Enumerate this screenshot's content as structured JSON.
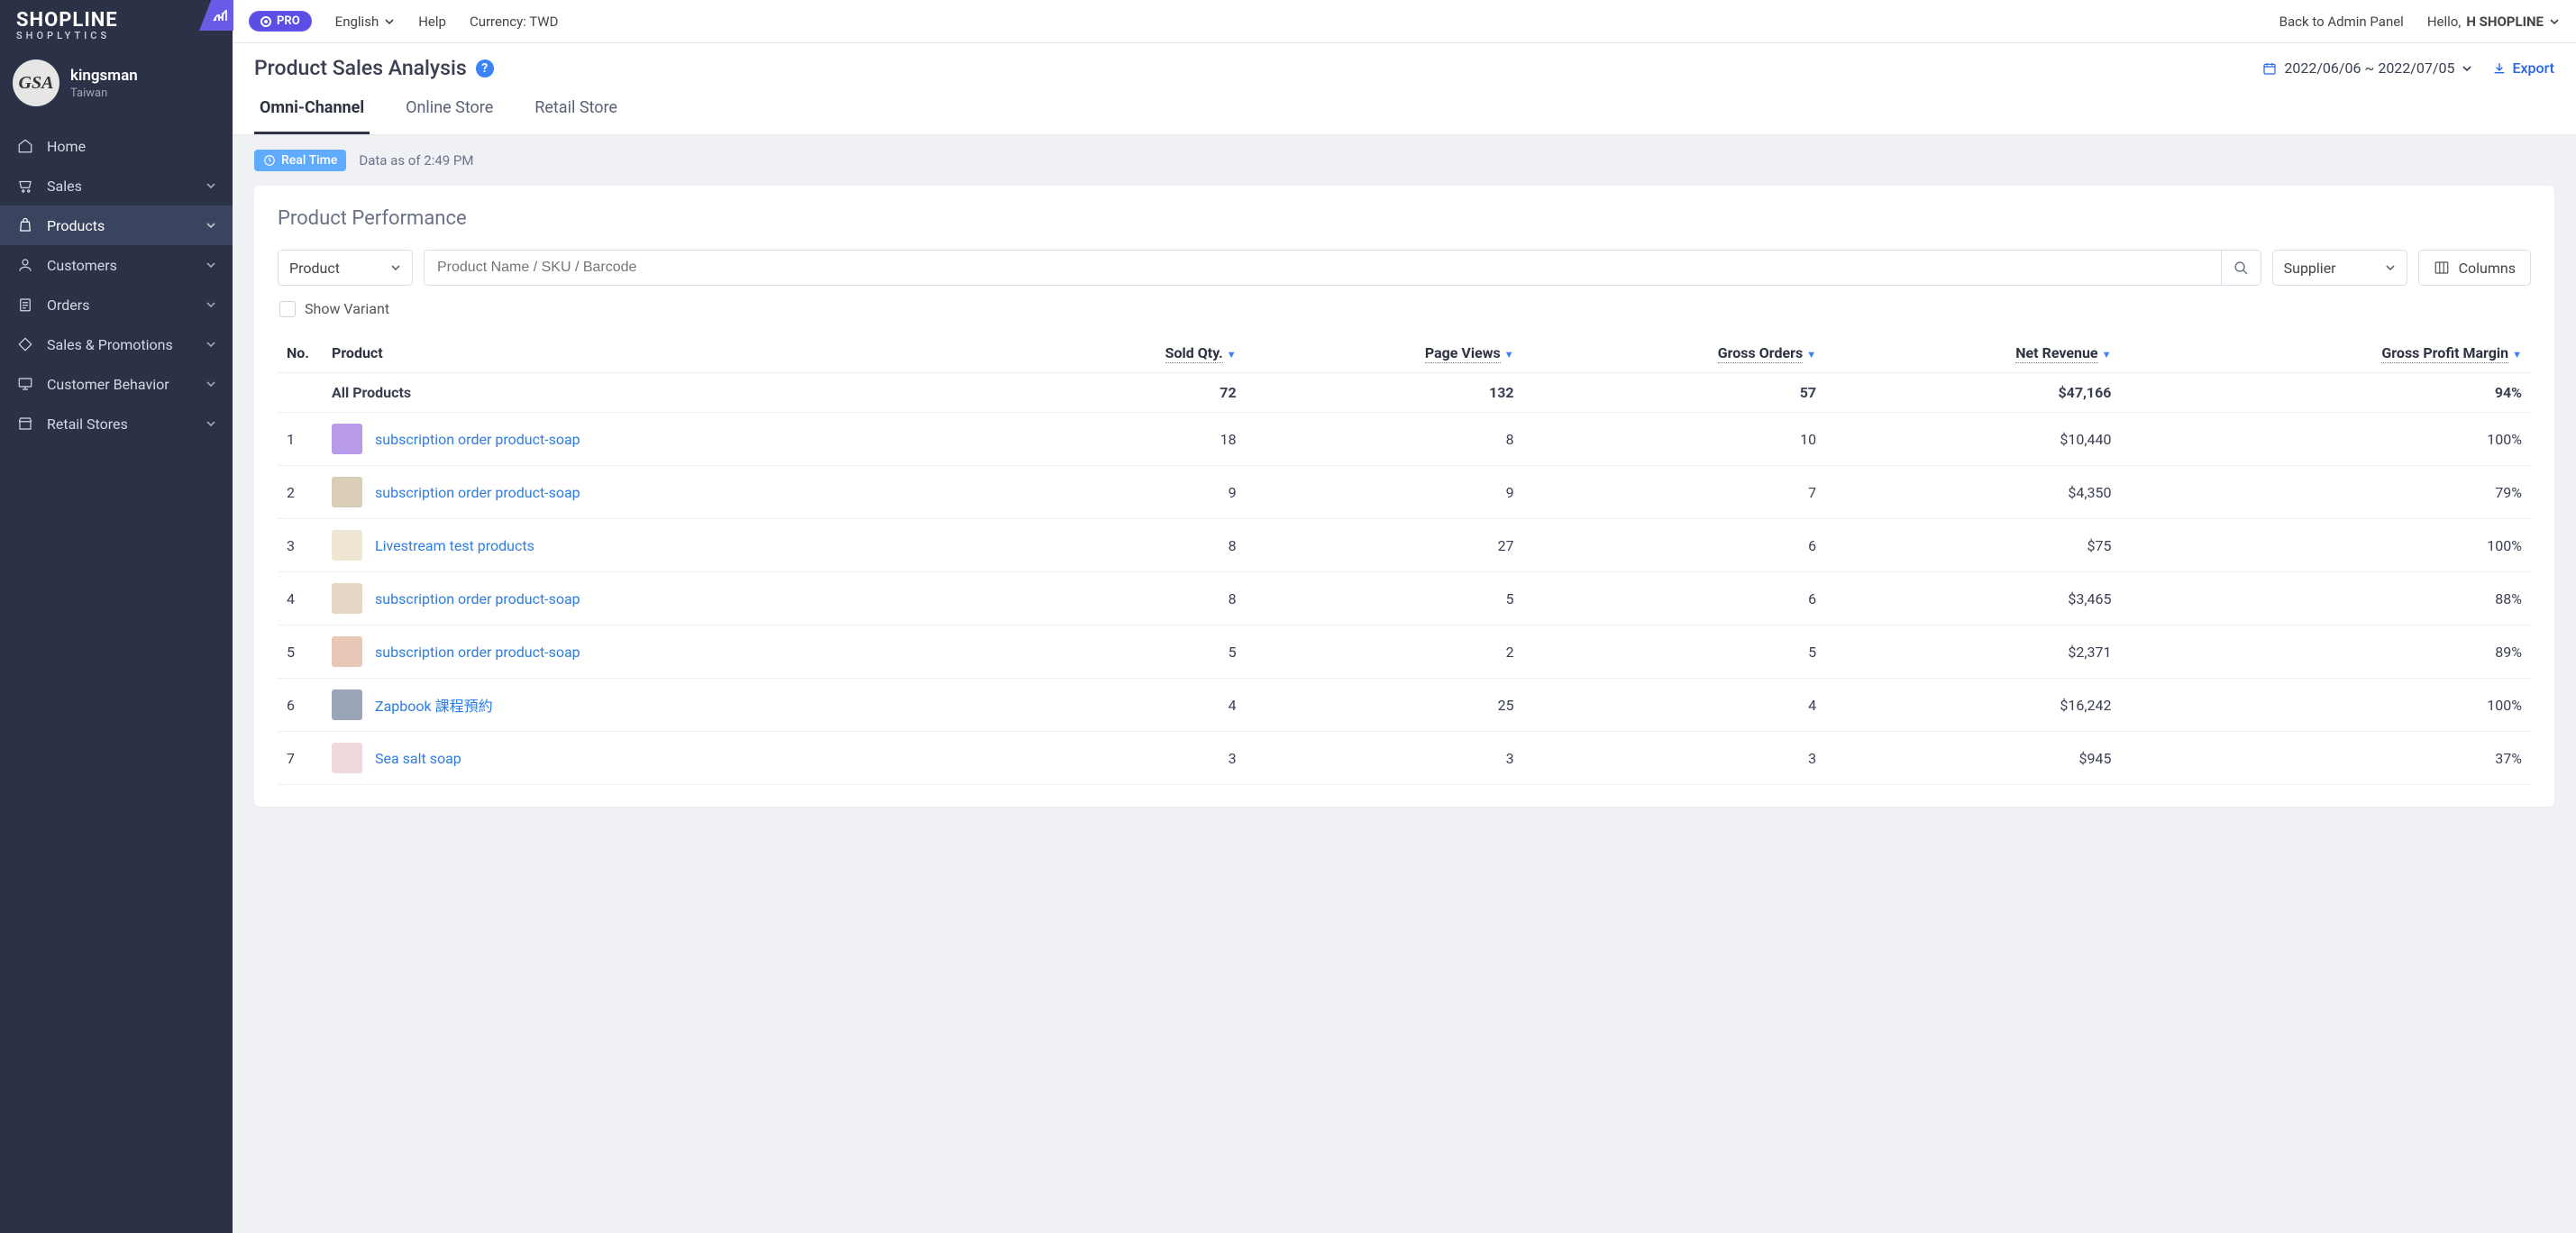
{
  "brand": {
    "name": "SHOPLINE",
    "sub": "SHOPLYTICS"
  },
  "tenant": {
    "avatarText": "GSA",
    "name": "kingsman",
    "location": "Taiwan"
  },
  "nav": {
    "home": "Home",
    "sales": "Sales",
    "products": "Products",
    "customers": "Customers",
    "orders": "Orders",
    "promotions": "Sales & Promotions",
    "behavior": "Customer Behavior",
    "retail": "Retail Stores"
  },
  "topbar": {
    "pro": "PRO",
    "language": "English",
    "help": "Help",
    "currency": "Currency: TWD",
    "back": "Back to Admin Panel",
    "helloPrefix": "Hello, ",
    "helloName": "H SHOPLINE"
  },
  "page": {
    "title": "Product Sales Analysis",
    "dateRange": "2022/06/06 ~ 2022/07/05",
    "export": "Export",
    "tabs": {
      "omni": "Omni-Channel",
      "online": "Online Store",
      "retail": "Retail Store"
    },
    "realtime": "Real Time",
    "dataAsOf": "Data as of 2:49 PM"
  },
  "card": {
    "title": "Product Performance",
    "filterType": "Product",
    "searchPlaceholder": "Product Name / SKU / Barcode",
    "supplier": "Supplier",
    "columns": "Columns",
    "showVariant": "Show Variant"
  },
  "table": {
    "headers": {
      "no": "No.",
      "product": "Product",
      "soldQty": "Sold Qty.",
      "pageViews": "Page Views",
      "grossOrders": "Gross Orders",
      "netRevenue": "Net Revenue",
      "margin": "Gross Profit Margin"
    },
    "totalLabel": "All Products",
    "totals": {
      "soldQty": "72",
      "pageViews": "132",
      "grossOrders": "57",
      "netRevenue": "$47,166",
      "margin": "94%"
    },
    "rows": [
      {
        "no": "1",
        "name": "subscription order product-soap",
        "soldQty": "18",
        "pageViews": "8",
        "grossOrders": "10",
        "netRevenue": "$10,440",
        "margin": "100%",
        "thumb": "#b79be8"
      },
      {
        "no": "2",
        "name": "subscription order product-soap",
        "soldQty": "9",
        "pageViews": "9",
        "grossOrders": "7",
        "netRevenue": "$4,350",
        "margin": "79%",
        "thumb": "#d9cdb8"
      },
      {
        "no": "3",
        "name": "Livestream test products",
        "soldQty": "8",
        "pageViews": "27",
        "grossOrders": "6",
        "netRevenue": "$75",
        "margin": "100%",
        "thumb": "#efe6d4"
      },
      {
        "no": "4",
        "name": "subscription order product-soap",
        "soldQty": "8",
        "pageViews": "5",
        "grossOrders": "6",
        "netRevenue": "$3,465",
        "margin": "88%",
        "thumb": "#e6d7c4"
      },
      {
        "no": "5",
        "name": "subscription order product-soap",
        "soldQty": "5",
        "pageViews": "2",
        "grossOrders": "5",
        "netRevenue": "$2,371",
        "margin": "89%",
        "thumb": "#e9c7b6"
      },
      {
        "no": "6",
        "name": "Zapbook 課程預約",
        "soldQty": "4",
        "pageViews": "25",
        "grossOrders": "4",
        "netRevenue": "$16,242",
        "margin": "100%",
        "thumb": "#9aa6b8"
      },
      {
        "no": "7",
        "name": "Sea salt soap",
        "soldQty": "3",
        "pageViews": "3",
        "grossOrders": "3",
        "netRevenue": "$945",
        "margin": "37%",
        "thumb": "#f0d9da"
      }
    ]
  }
}
